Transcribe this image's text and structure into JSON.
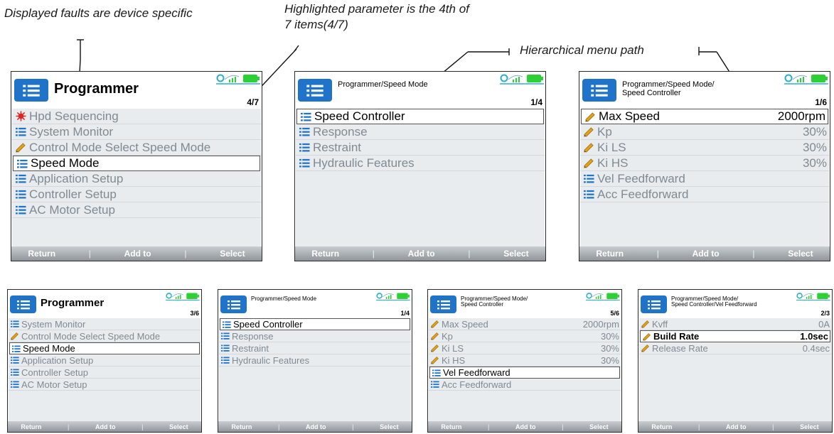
{
  "annotations": {
    "faults": "Displayed faults are device specific",
    "highlighted": "Highlighted parameter is the 4th of\n7 items(4/7)",
    "path": "Hierarchical menu path"
  },
  "colors": {
    "accent_blue": "#1f73c9",
    "status_cyan": "#2ab0c9",
    "battery_green": "#2dd136",
    "list_bg": "#e9ecef"
  },
  "softkeys": {
    "left": "Return",
    "middle": "Add to",
    "right": "Select",
    "sep": "|"
  },
  "icons": {
    "menu": "list-icon",
    "edit": "pencil-icon",
    "fault": "fault-icon",
    "status": "signal-battery-icon"
  },
  "screens": [
    {
      "title": "Programmer",
      "counter": "4/7",
      "items": [
        {
          "icon": "fault",
          "label": "Hpd Sequencing",
          "value": ""
        },
        {
          "icon": "menu",
          "label": "System Monitor",
          "value": ""
        },
        {
          "icon": "edit",
          "label": "Control Mode Select  Speed Mode",
          "value": ""
        },
        {
          "icon": "menu",
          "label": "Speed Mode",
          "value": "",
          "selected": true
        },
        {
          "icon": "menu",
          "label": "Application Setup",
          "value": ""
        },
        {
          "icon": "menu",
          "label": "Controller Setup",
          "value": ""
        },
        {
          "icon": "menu",
          "label": "AC Motor Setup",
          "value": ""
        }
      ]
    },
    {
      "title": "Programmer/Speed Mode",
      "counter": "1/4",
      "items": [
        {
          "icon": "menu",
          "label": "Speed Controller",
          "value": "",
          "selected": true
        },
        {
          "icon": "menu",
          "label": "Response",
          "value": ""
        },
        {
          "icon": "menu",
          "label": "Restraint",
          "value": ""
        },
        {
          "icon": "menu",
          "label": "Hydraulic Features",
          "value": ""
        }
      ]
    },
    {
      "title": "Programmer/Speed Mode/\nSpeed Controller",
      "counter": "1/6",
      "items": [
        {
          "icon": "edit",
          "label": "Max Speed",
          "value": "2000rpm",
          "selected": true
        },
        {
          "icon": "edit",
          "label": "Kp",
          "value": "30%"
        },
        {
          "icon": "edit",
          "label": "Ki LS",
          "value": "30%"
        },
        {
          "icon": "edit",
          "label": "Ki HS",
          "value": "30%"
        },
        {
          "icon": "menu",
          "label": "Vel Feedforward",
          "value": ""
        },
        {
          "icon": "menu",
          "label": "Acc Feedforward",
          "value": ""
        }
      ]
    },
    {
      "title": "Programmer",
      "counter": "3/6",
      "items": [
        {
          "icon": "menu",
          "label": "System Monitor",
          "value": ""
        },
        {
          "icon": "edit",
          "label": "Control Mode Select  Speed Mode",
          "value": ""
        },
        {
          "icon": "menu",
          "label": "Speed Mode",
          "value": "",
          "selected": true
        },
        {
          "icon": "menu",
          "label": "Application Setup",
          "value": ""
        },
        {
          "icon": "menu",
          "label": "Controller Setup",
          "value": ""
        },
        {
          "icon": "menu",
          "label": "AC Motor Setup",
          "value": ""
        }
      ]
    },
    {
      "title": "Programmer/Speed Mode",
      "counter": "1/4",
      "items": [
        {
          "icon": "menu",
          "label": "Speed Controller",
          "value": "",
          "selected": true
        },
        {
          "icon": "menu",
          "label": "Response",
          "value": ""
        },
        {
          "icon": "menu",
          "label": "Restraint",
          "value": ""
        },
        {
          "icon": "menu",
          "label": "Hydraulic Features",
          "value": ""
        }
      ]
    },
    {
      "title": "Programmer/Speed Mode/\nSpeed Controller",
      "counter": "5/6",
      "items": [
        {
          "icon": "edit",
          "label": "Max Speed",
          "value": "2000rpm"
        },
        {
          "icon": "edit",
          "label": "Kp",
          "value": "30%"
        },
        {
          "icon": "edit",
          "label": "Ki LS",
          "value": "30%"
        },
        {
          "icon": "edit",
          "label": "Ki HS",
          "value": "30%"
        },
        {
          "icon": "menu",
          "label": "Vel Feedforward",
          "value": "",
          "selected": true
        },
        {
          "icon": "menu",
          "label": "Acc Feedforward",
          "value": ""
        }
      ]
    },
    {
      "title": "Programmer/Speed Mode/\nSpeed Controller/Vel Feedforward",
      "counter": "2/3",
      "items": [
        {
          "icon": "edit",
          "label": "Kvff",
          "value": "0A"
        },
        {
          "icon": "edit",
          "label": "Build Rate",
          "value": "1.0sec",
          "selected": true
        },
        {
          "icon": "edit",
          "label": "Release Rate",
          "value": "0.4sec"
        }
      ]
    }
  ]
}
